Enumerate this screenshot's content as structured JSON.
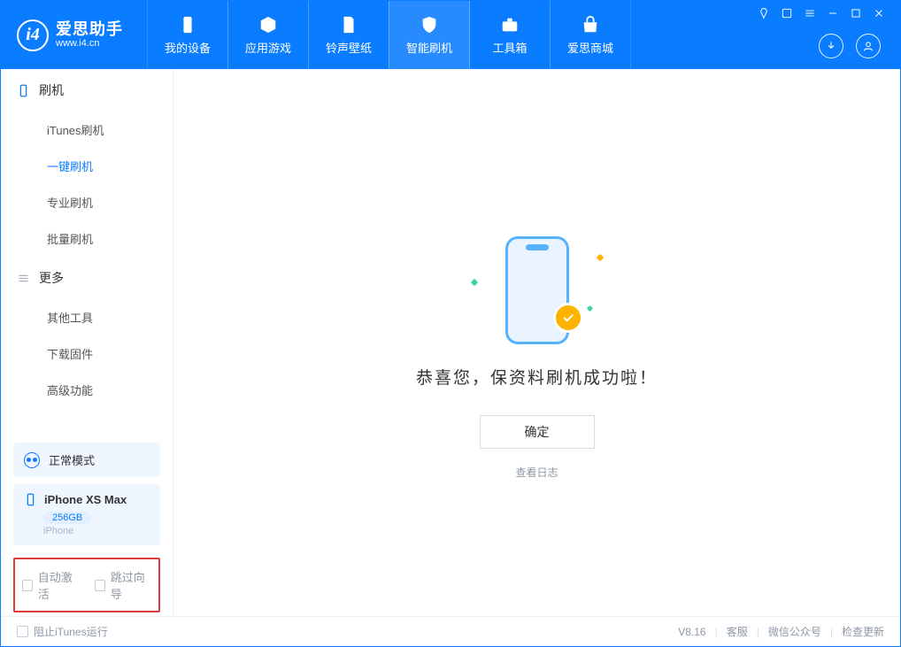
{
  "app": {
    "name_cn": "爱思助手",
    "name_en": "www.i4.cn"
  },
  "tabs": {
    "device": "我的设备",
    "apps": "应用游戏",
    "ring": "铃声壁纸",
    "flash": "智能刷机",
    "tools": "工具箱",
    "store": "爱思商城"
  },
  "sidebar": {
    "group_flash": "刷机",
    "items_flash": {
      "itunes": "iTunes刷机",
      "oneclick": "一键刷机",
      "pro": "专业刷机",
      "batch": "批量刷机"
    },
    "group_more": "更多",
    "items_more": {
      "other": "其他工具",
      "firmware": "下载固件",
      "advanced": "高级功能"
    },
    "mode": "正常模式",
    "device_name": "iPhone XS Max",
    "device_capacity": "256GB",
    "device_type": "iPhone",
    "auto_activate": "自动激活",
    "skip_setup": "跳过向导"
  },
  "main": {
    "success_msg": "恭喜您，保资料刷机成功啦！",
    "ok": "确定",
    "view_log": "查看日志"
  },
  "footer": {
    "block_itunes": "阻止iTunes运行",
    "version": "V8.16",
    "support": "客服",
    "wechat": "微信公众号",
    "update": "检查更新"
  }
}
